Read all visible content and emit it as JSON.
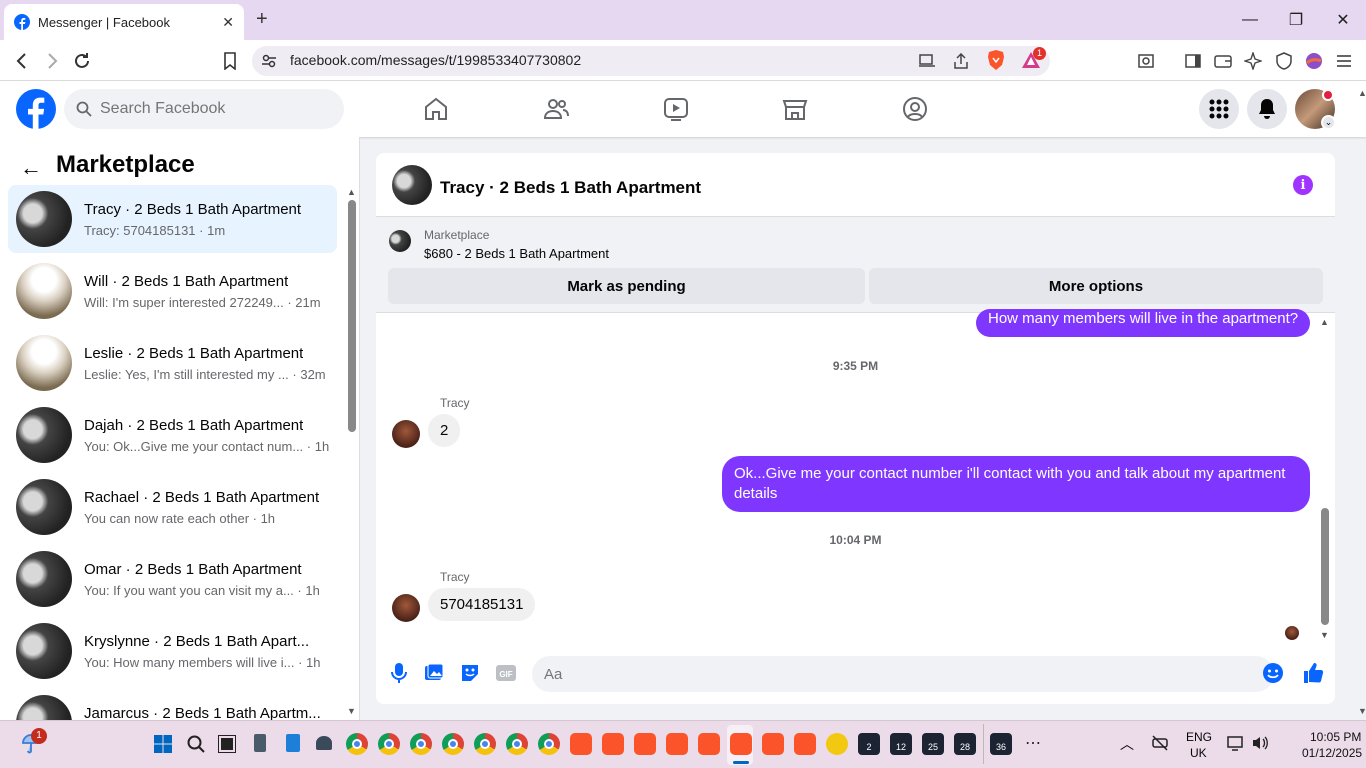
{
  "browser": {
    "tab_title": "Messenger | Facebook",
    "url": "facebook.com/messages/t/1998533407730802",
    "brave_badge": "1"
  },
  "fb": {
    "search_placeholder": "Search Facebook"
  },
  "left": {
    "title": "Marketplace",
    "conversations": [
      {
        "title": "Tracy · 2 Beds 1 Bath Apartment",
        "sub": "Tracy: 5704185131 · 1m"
      },
      {
        "title": "Will · 2 Beds 1 Bath Apartment",
        "sub": "Will: I'm super interested 272249... · 21m"
      },
      {
        "title": "Leslie · 2 Beds 1 Bath Apartment",
        "sub": "Leslie: Yes, I'm still interested my ... · 32m"
      },
      {
        "title": "Dajah · 2 Beds 1 Bath Apartment",
        "sub": "You: Ok...Give me your contact num... · 1h"
      },
      {
        "title": "Rachael · 2 Beds 1 Bath Apartment",
        "sub": "You can now rate each other · 1h"
      },
      {
        "title": "Omar · 2 Beds 1 Bath Apartment",
        "sub": "You: If you want you can visit my a... · 1h"
      },
      {
        "title": "Kryslynne · 2 Beds 1 Bath Apart...",
        "sub": "You: How many members will live i... · 1h"
      },
      {
        "title": "Jamarcus · 2 Beds 1 Bath Apartm...",
        "sub": ""
      }
    ]
  },
  "chat": {
    "title": "Tracy · 2 Beds 1 Bath Apartment",
    "listing_category": "Marketplace",
    "listing_price": "$680 - 2 Beds 1 Bath Apartment",
    "mark_pending": "Mark as pending",
    "more_options": "More options",
    "msg_out_1": "How many members will live in the apartment?",
    "time_1": "9:35 PM",
    "sender_1": "Tracy",
    "msg_in_1": "2",
    "msg_out_2": "Ok...Give me your contact number i'll contact with you and talk about my apartment details",
    "time_2": "10:04 PM",
    "sender_2": "Tracy",
    "msg_in_2": "5704185131",
    "composer_placeholder": "Aa"
  },
  "taskbar": {
    "notif_badge": "1",
    "lang_1": "ENG",
    "lang_2": "UK",
    "time": "10:05 PM",
    "date": "01/12/2025",
    "badges": [
      "2",
      "12",
      "25",
      "28",
      "36"
    ]
  }
}
